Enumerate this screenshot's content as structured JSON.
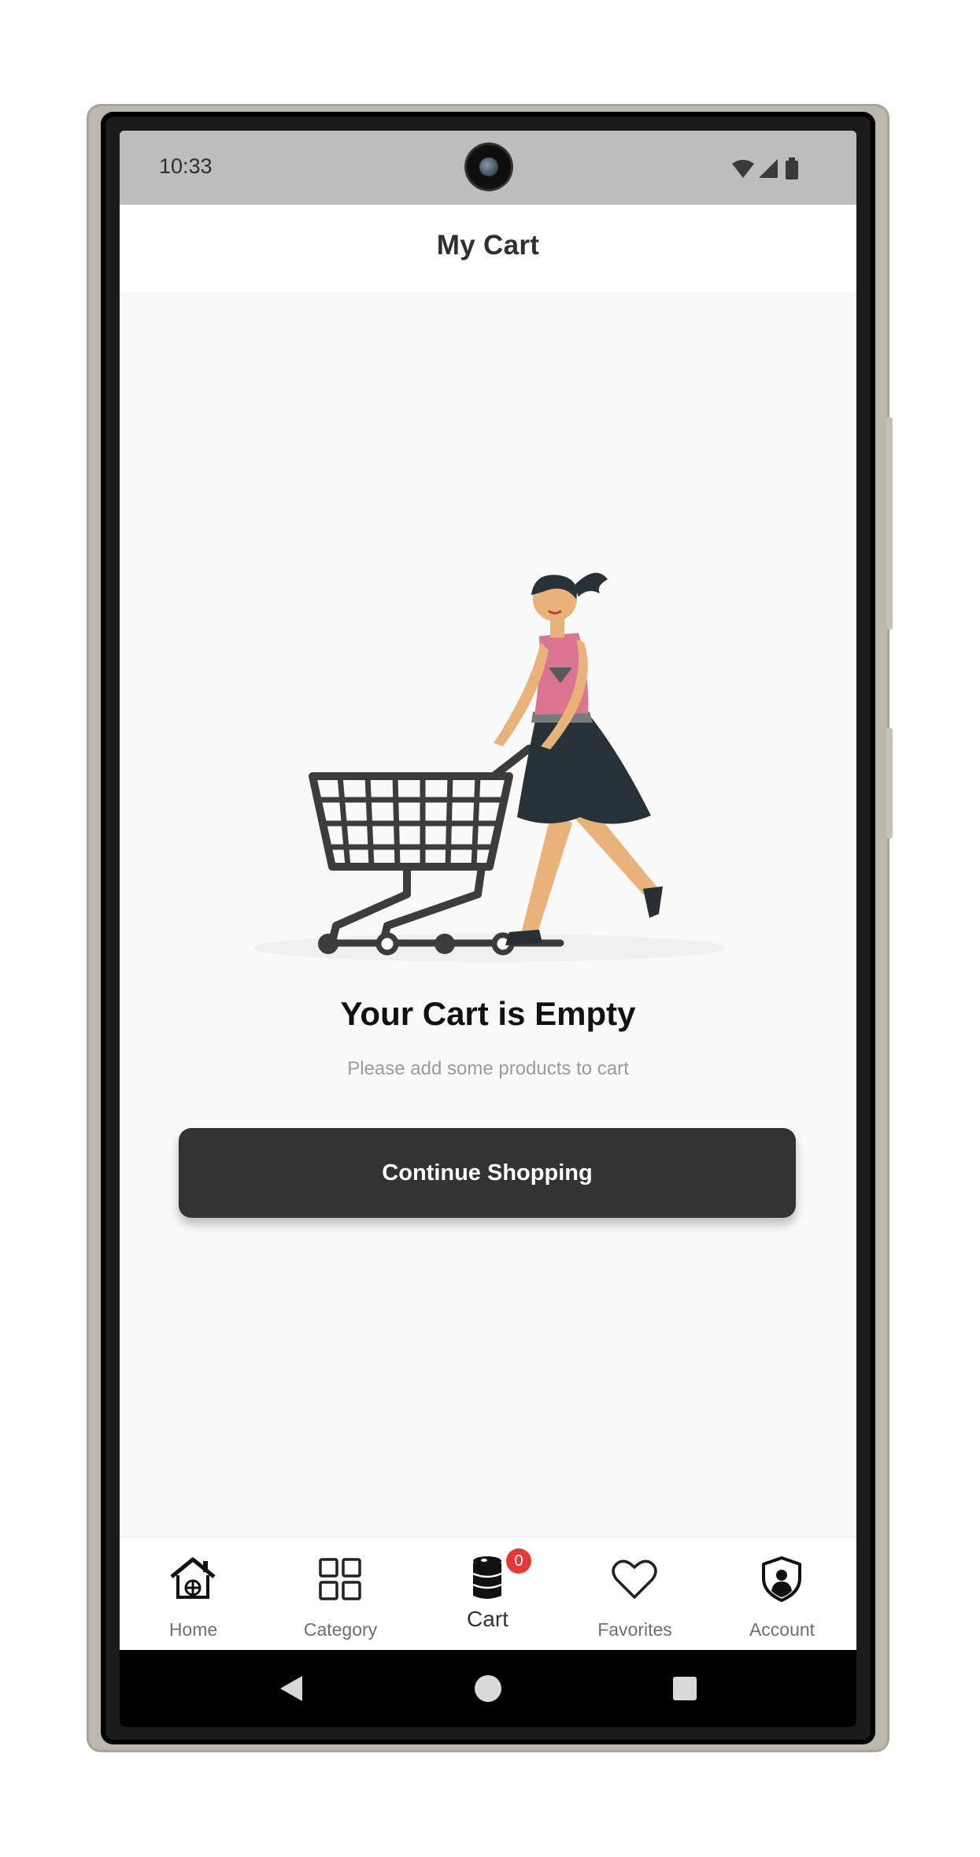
{
  "status_bar": {
    "time": "10:33",
    "icons": [
      "wifi-icon",
      "signal-icon",
      "battery-icon"
    ]
  },
  "app_bar": {
    "title": "My Cart"
  },
  "empty_state": {
    "illustration": "woman-pushing-shopping-cart",
    "title": "Your Cart is Empty",
    "subtitle": "Please add some products to cart"
  },
  "actions": {
    "continue_label": "Continue Shopping"
  },
  "bottom_nav": {
    "items": [
      {
        "label": "Home",
        "icon": "home-icon",
        "active": false
      },
      {
        "label": "Category",
        "icon": "grid-icon",
        "active": false
      },
      {
        "label": "Cart",
        "icon": "cart-barrel-icon",
        "active": true,
        "badge": "0"
      },
      {
        "label": "Favorites",
        "icon": "heart-icon",
        "active": false
      },
      {
        "label": "Account",
        "icon": "shield-user-icon",
        "active": false
      }
    ]
  },
  "system_nav": [
    "back-icon",
    "home-circle-icon",
    "recents-icon"
  ],
  "colors": {
    "primary": "#333333",
    "badge": "#E53935",
    "status_bar": "#BDBDBD",
    "background": "#F9F9F9"
  }
}
